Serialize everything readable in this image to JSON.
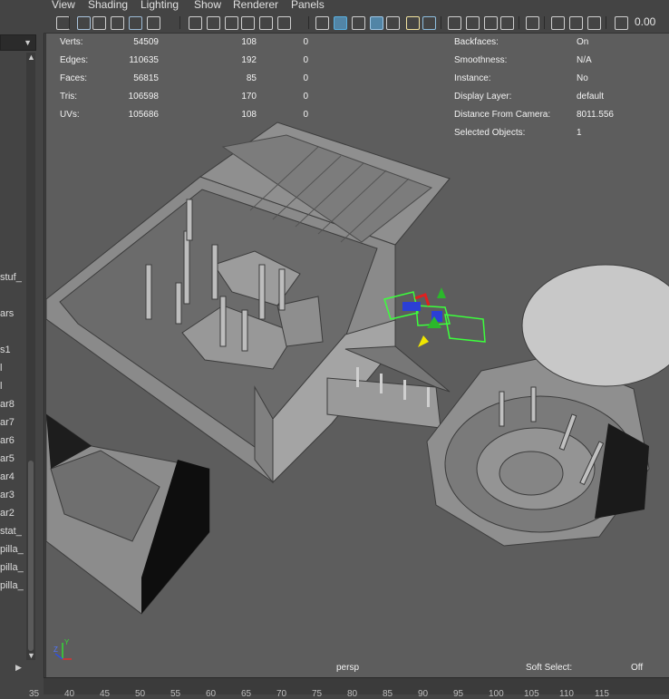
{
  "outliner": {
    "items": [
      "_stuf",
      "ars",
      "s1",
      "l",
      "l",
      "ar8",
      "ar7",
      "ar6",
      "ar5",
      "ar4",
      "ar3",
      "ar2",
      "_stat",
      "_pilla",
      "_pilla",
      "_pilla"
    ]
  },
  "menu": [
    "View",
    "Shading",
    "Lighting",
    "Show",
    "Renderer",
    "Panels"
  ],
  "toolbar": {
    "icons": [
      "select-camera-icon",
      "camera-attributes-icon",
      "bookmark-icon",
      "image-plane-icon",
      "grease-pencil-icon",
      "grid-icon",
      "film-gate-icon",
      "resolution-gate-icon",
      "gate-mask-icon",
      "field-chart-icon",
      "safe-action-icon",
      "safe-title-icon",
      "wireframe-icon",
      "smooth-shade-icon",
      "default-material-icon",
      "wireframe-on-shaded-icon",
      "textured-icon",
      "use-all-lights-icon",
      "shadows-icon",
      "screen-space-ambient-occlusion-icon",
      "motion-blur-icon",
      "multisample-antialiasing-icon",
      "depth-of-field-icon",
      "isolate-select-icon",
      "xray-icon",
      "xray-joints-icon",
      "xray-active-components-icon",
      "exposure-icon"
    ],
    "exposure_value": "0.00"
  },
  "hud": {
    "stats": [
      {
        "label": "Verts:",
        "v1": "54509",
        "v2": "108",
        "v3": "0"
      },
      {
        "label": "Edges:",
        "v1": "110635",
        "v2": "192",
        "v3": "0"
      },
      {
        "label": "Faces:",
        "v1": "56815",
        "v2": "85",
        "v3": "0"
      },
      {
        "label": "Tris:",
        "v1": "106598",
        "v2": "170",
        "v3": "0"
      },
      {
        "label": "UVs:",
        "v1": "105686",
        "v2": "108",
        "v3": "0"
      }
    ],
    "info": [
      {
        "label": "Backfaces:",
        "value": "On"
      },
      {
        "label": "Smoothness:",
        "value": "N/A"
      },
      {
        "label": "Instance:",
        "value": "No"
      },
      {
        "label": "Display Layer:",
        "value": "default"
      },
      {
        "label": "Distance From Camera:",
        "value": "8011.556"
      },
      {
        "label": "Selected Objects:",
        "value": "1"
      }
    ],
    "camera_name": "persp",
    "soft_select_label": "Soft Select:",
    "soft_select_value": "Off"
  },
  "ruler": {
    "ticks": [
      "35",
      "40",
      "45",
      "50",
      "55",
      "60",
      "65",
      "70",
      "75",
      "80",
      "85",
      "90",
      "95",
      "100",
      "105",
      "110",
      "115"
    ]
  }
}
